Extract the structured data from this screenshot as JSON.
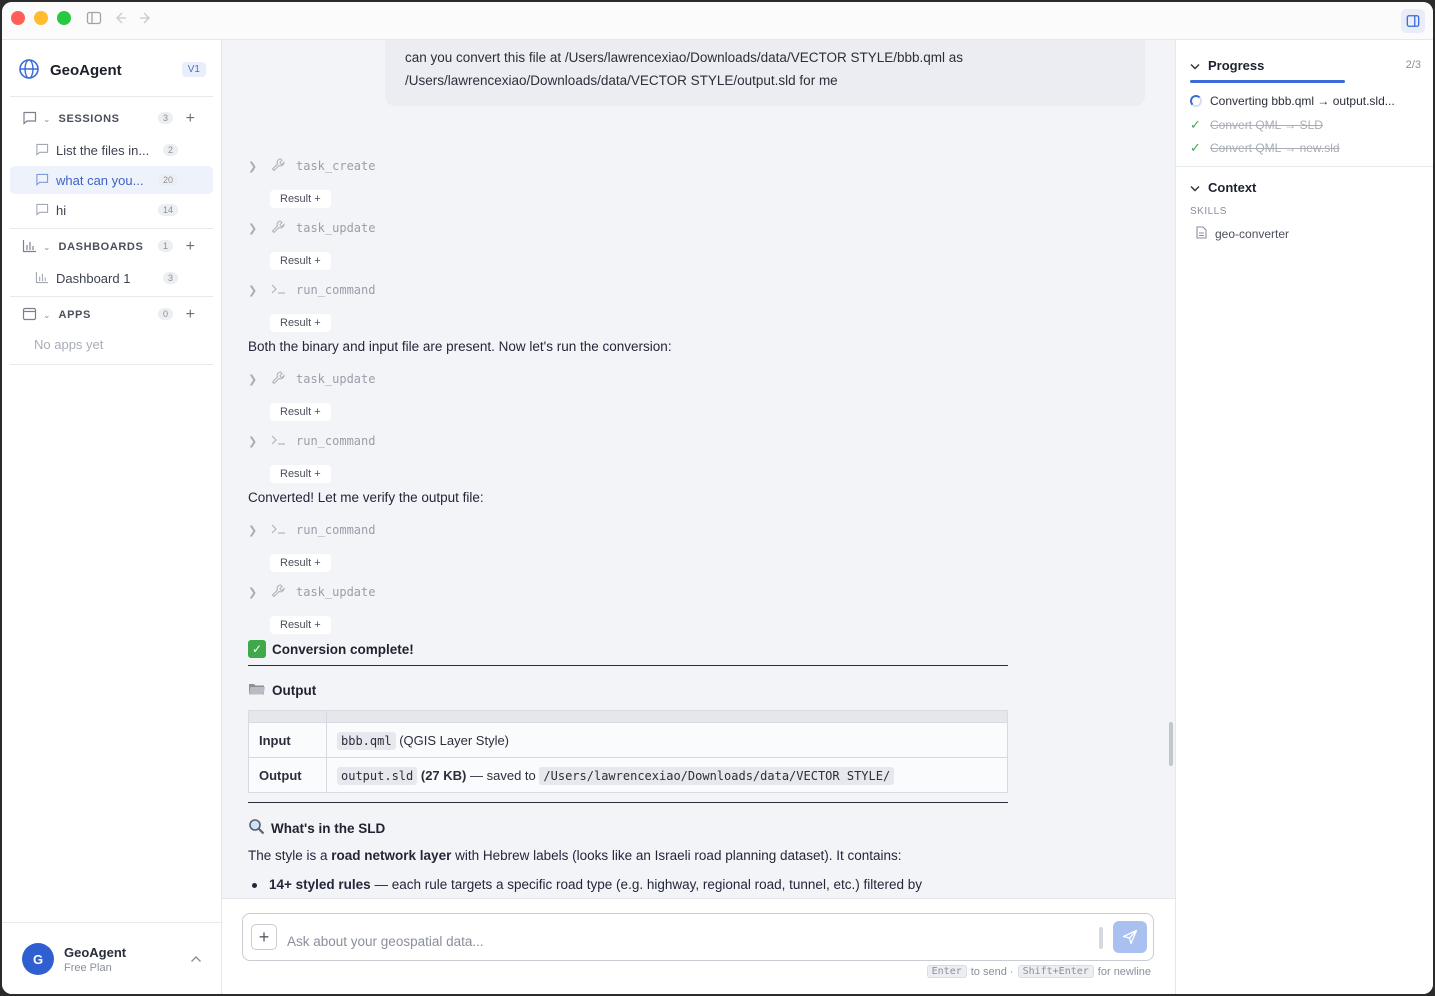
{
  "brand": {
    "name": "GeoAgent",
    "version": "V1"
  },
  "sidebar": {
    "sessions": {
      "label": "SESSIONS",
      "count": "3",
      "items": [
        {
          "label": "List the files in...",
          "count": "2"
        },
        {
          "label": "what can you...",
          "count": "20"
        },
        {
          "label": "hi",
          "count": "14"
        }
      ]
    },
    "dashboards": {
      "label": "DASHBOARDS",
      "count": "1",
      "items": [
        {
          "label": "Dashboard 1",
          "count": "3"
        }
      ]
    },
    "apps": {
      "label": "APPS",
      "count": "0",
      "empty": "No apps yet"
    }
  },
  "user": {
    "initial": "G",
    "name": "GeoAgent",
    "plan": "Free Plan"
  },
  "chat": {
    "user_message_line1": "can you convert this file at /Users/lawrencexiao/Downloads/data/VECTOR STYLE/bbb.qml as",
    "user_message_line2": "/Users/lawrencexiao/Downloads/data/VECTOR STYLE/output.sld for me",
    "result_label": "Result +",
    "tools": {
      "t1": "task_create",
      "t2": "task_update",
      "t3": "run_command",
      "t4": "task_update",
      "t5": "run_command",
      "t6": "run_command",
      "t7": "task_update"
    },
    "msg1": "Both the binary and input file are present. Now let's run the conversion:",
    "msg2": "Converted! Let me verify the output file:",
    "complete_heading": "Conversion complete!",
    "output_heading": "Output",
    "table": {
      "row1": {
        "key": "Input",
        "code": "bbb.qml",
        "rest": "(QGIS Layer Style)"
      },
      "row2": {
        "key": "Output",
        "code": "output.sld",
        "size": "(27 KB)",
        "rest": "— saved to",
        "path": "/Users/lawrencexiao/Downloads/data/VECTOR STYLE/"
      }
    },
    "sld_heading": "What's in the SLD",
    "sld_intro_a": "The style is a ",
    "sld_intro_b": "road network layer",
    "sld_intro_c": " with Hebrew labels (looks like an Israeli road planning dataset). It contains:",
    "bullet1_b": "14+ styled rules",
    "bullet1_rest": " — each rule targets a specific road type (e.g. highway, regional road, tunnel, etc.) filtered by"
  },
  "composer": {
    "placeholder": "Ask about your geospatial data...",
    "hint_enter": "Enter",
    "hint_send": "to send ·",
    "hint_shift": "Shift+Enter",
    "hint_newline": "for newline"
  },
  "panel": {
    "progress_label": "Progress",
    "progress_count": "2/3",
    "progress_fraction": 0.67,
    "tasks": [
      {
        "label": "Converting bbb.qml → output.sld..."
      },
      {
        "label": "Convert QML → SLD"
      },
      {
        "label": "Convert QML → new.sld"
      }
    ],
    "context_label": "Context",
    "skills_label": "SKILLS",
    "skill": "geo-converter"
  },
  "colors": {
    "accent": "#3b6bd8",
    "success": "#3ea84a",
    "traffic_red": "#ff5f57",
    "traffic_yellow": "#febc2e",
    "traffic_green": "#28c840"
  }
}
